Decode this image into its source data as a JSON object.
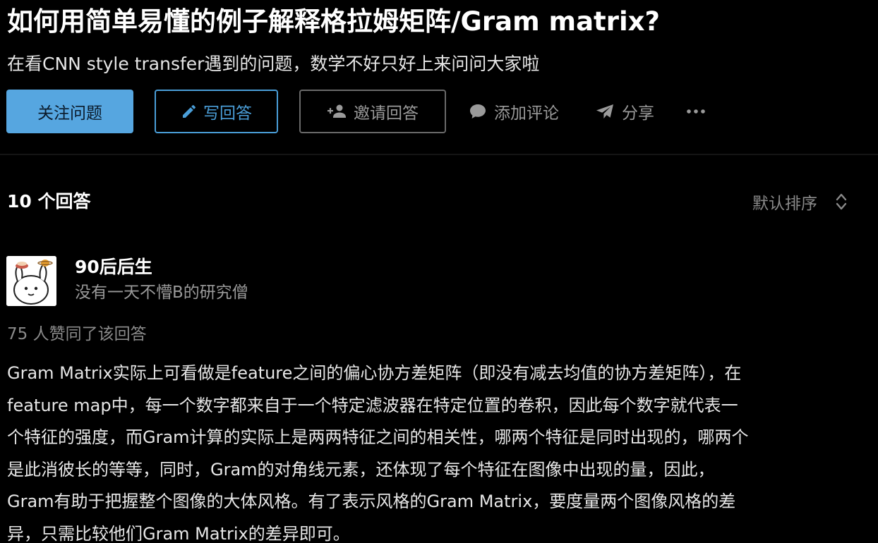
{
  "question": {
    "title": "如何用简单易懂的例子解释格拉姆矩阵/Gram matrix?",
    "detail": "在看CNN style transfer遇到的问题，数学不好只好上来问问大家啦"
  },
  "actions": {
    "follow_label": "关注问题",
    "write_label": "写回答",
    "invite_label": "邀请回答",
    "comment_label": "添加评论",
    "share_label": "分享",
    "more_label": "···"
  },
  "answers_header": {
    "count_label": "10 个回答",
    "sort_label": "默认排序"
  },
  "answer": {
    "author_name": "90后后生",
    "author_bio": "没有一天不懵B的研究僧",
    "vote_text": "75 人赞同了该回答",
    "lines": [
      "Gram Matrix实际上可看做是feature之间的偏心协方差矩阵（即没有减去均值的协方差矩阵），在",
      "feature map中，每一个数字都来自于一个特定滤波器在特定位置的卷积，因此每个数字就代表一",
      "个特征的强度，而Gram计算的实际上是两两特征之间的相关性，哪两个特征是同时出现的，哪两个",
      "是此消彼长的等等，同时，Gram的对角线元素，还体现了每个特征在图像中出现的量，因此，",
      "Gram有助于把握整个图像的大体风格。有了表示风格的Gram Matrix，要度量两个图像风格的差",
      "异，只需比较他们Gram Matrix的差异即可。"
    ]
  },
  "icons": {
    "write": "pencil-icon",
    "invite": "add-person-icon",
    "comment": "comment-bubble-icon",
    "share": "paper-plane-icon",
    "more": "more-dots-icon",
    "sort": "sort-chevrons-icon"
  },
  "colors": {
    "background": "#000000",
    "primary": "#56a6e0",
    "text": "#e6e6e6",
    "muted": "#8a8a8a"
  }
}
